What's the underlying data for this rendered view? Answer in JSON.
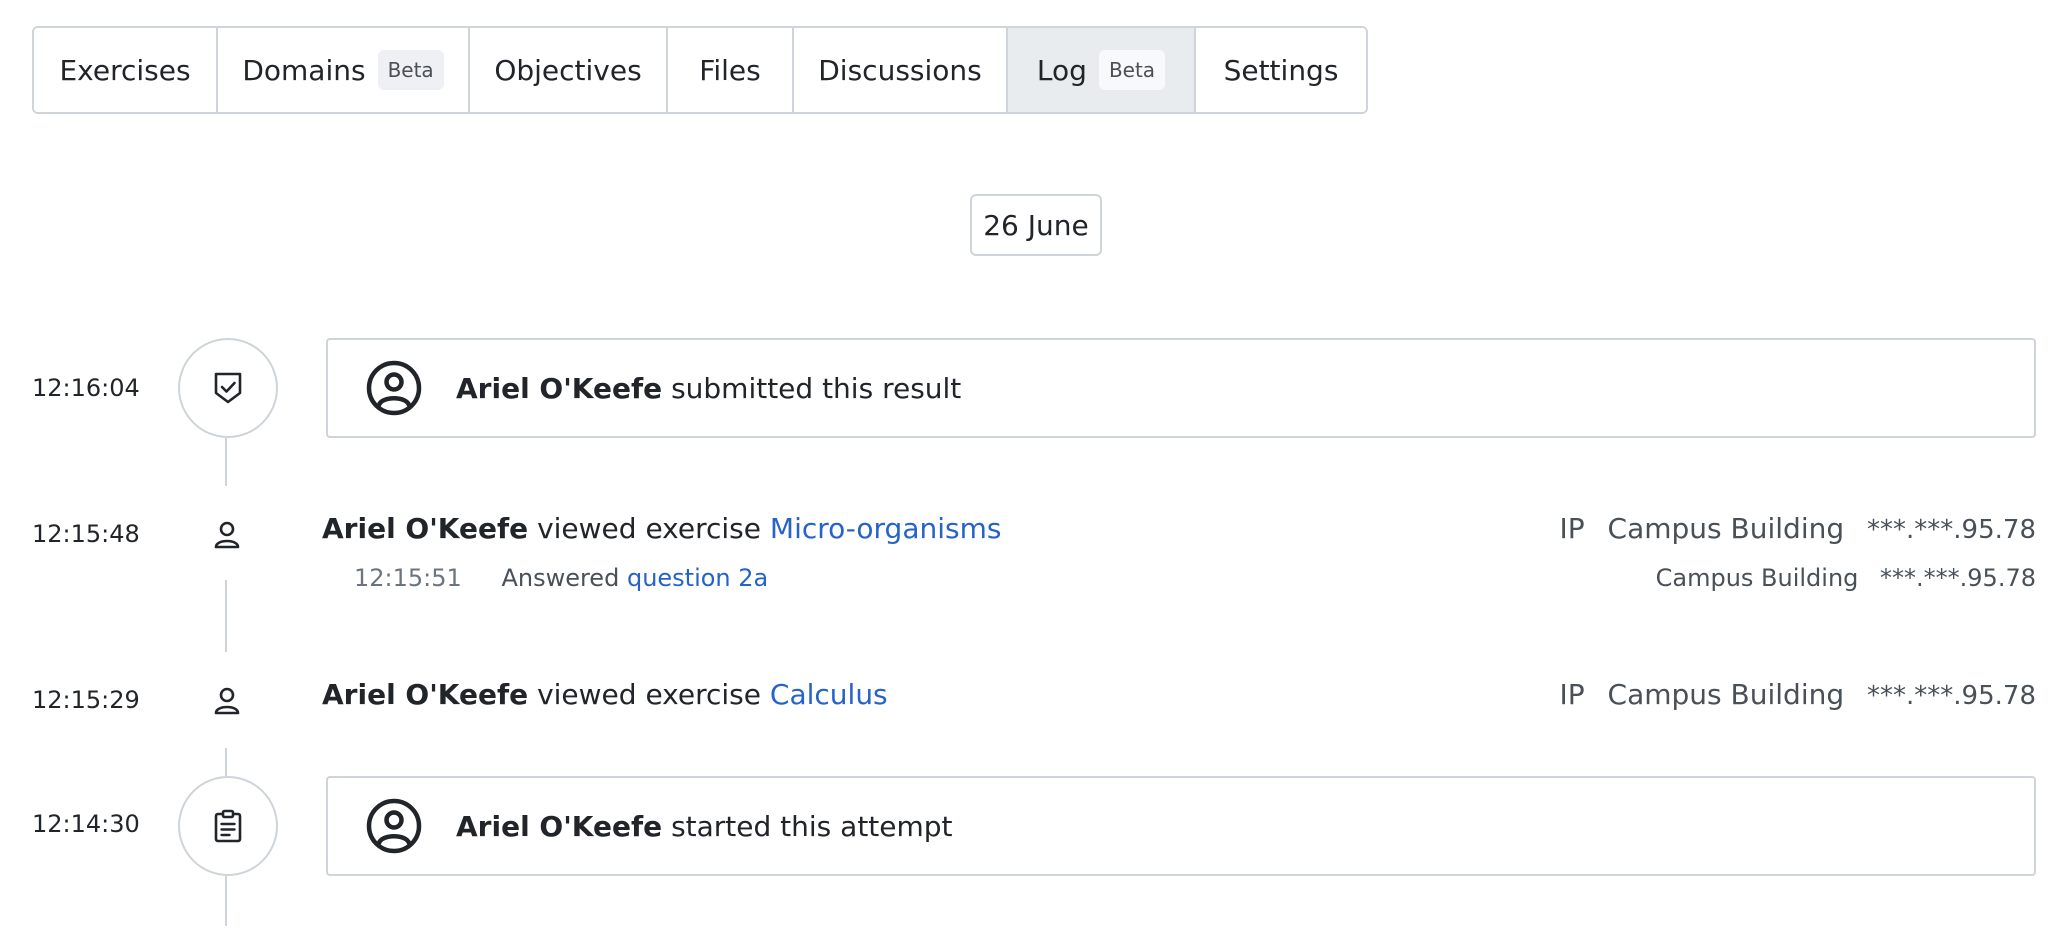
{
  "tabs": [
    {
      "label": "Exercises",
      "badge": null,
      "active": false
    },
    {
      "label": "Domains",
      "badge": "Beta",
      "active": false
    },
    {
      "label": "Objectives",
      "badge": null,
      "active": false
    },
    {
      "label": "Files",
      "badge": null,
      "active": false
    },
    {
      "label": "Discussions",
      "badge": null,
      "active": false
    },
    {
      "label": "Log",
      "badge": "Beta",
      "active": true
    },
    {
      "label": "Settings",
      "badge": null,
      "active": false
    }
  ],
  "date_label": "26 June",
  "events": [
    {
      "time": "12:16:04",
      "type": "card",
      "icon": "shield-check-icon",
      "user": "Ariel O'Keefe",
      "text": "submitted this result"
    },
    {
      "time": "12:15:48",
      "type": "view",
      "icon": "user-icon",
      "user": "Ariel O'Keefe",
      "text": "viewed exercise",
      "link": "Micro-organisms",
      "ip_label": "IP",
      "location": "Campus Building",
      "ip": "***.***.95.78",
      "sub": {
        "time": "12:15:51",
        "text": "Answered",
        "link": "question 2a",
        "location": "Campus Building",
        "ip": "***.***.95.78"
      }
    },
    {
      "time": "12:15:29",
      "type": "view",
      "icon": "user-icon",
      "user": "Ariel O'Keefe",
      "text": "viewed exercise",
      "link": "Calculus",
      "ip_label": "IP",
      "location": "Campus Building",
      "ip": "***.***.95.78"
    },
    {
      "time": "12:14:30",
      "type": "card",
      "icon": "clipboard-icon",
      "user": "Ariel O'Keefe",
      "text": "started this attempt"
    }
  ],
  "colors": {
    "link": "#2563c9",
    "border": "#ced4da",
    "active_tab": "#e9ecef"
  }
}
